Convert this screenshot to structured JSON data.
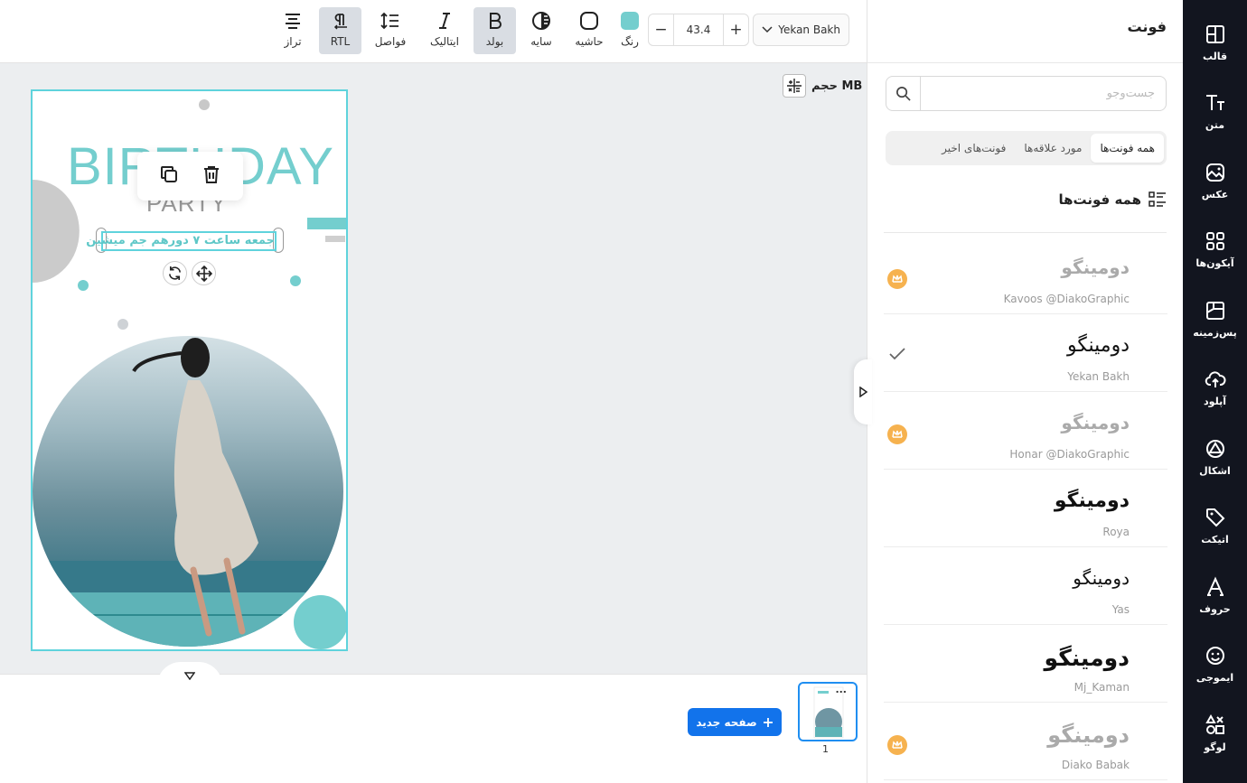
{
  "rail": {
    "items": [
      {
        "label": "قالب",
        "icon": "layout-icon"
      },
      {
        "label": "متن",
        "icon": "text-icon"
      },
      {
        "label": "عکس",
        "icon": "image-icon"
      },
      {
        "label": "آیکون‌ها",
        "icon": "grid-icon"
      },
      {
        "label": "پس‌زمینه",
        "icon": "background-icon"
      },
      {
        "label": "آپلود",
        "icon": "upload-icon"
      },
      {
        "label": "اشکال",
        "icon": "shapes-icon"
      },
      {
        "label": "اتیکت",
        "icon": "tag-icon"
      },
      {
        "label": "حروف",
        "icon": "letters-icon"
      },
      {
        "label": "ایموجی",
        "icon": "emoji-icon"
      },
      {
        "label": "لوگو",
        "icon": "logo-icon"
      }
    ]
  },
  "panel": {
    "title": "فونت",
    "search_placeholder": "جست‌وجو",
    "tabs": [
      "همه فونت‌ها",
      "مورد علاقه‌ها",
      "فونت‌های اخیر"
    ],
    "section_title": "همه فونت‌ها",
    "fonts": [
      {
        "sample": "دومینگو",
        "name": "Kavoos @DiakoGraphic",
        "premium": true,
        "selected": false
      },
      {
        "sample": "دومینگو",
        "name": "Yekan Bakh",
        "premium": false,
        "selected": true
      },
      {
        "sample": "دومینگو",
        "name": "Honar @DiakoGraphic",
        "premium": true,
        "selected": false
      },
      {
        "sample": "دومینگو",
        "name": "Roya",
        "premium": false,
        "selected": false
      },
      {
        "sample": "دومینگو",
        "name": "Yas",
        "premium": false,
        "selected": false
      },
      {
        "sample": "دومینگو",
        "name": "Mj_Kaman",
        "premium": false,
        "selected": false
      },
      {
        "sample": "دومینگو",
        "name": "Diako Babak",
        "premium": true,
        "selected": false
      }
    ]
  },
  "toolbar": {
    "font_family": "Yekan Bakh",
    "font_size": "43.4",
    "color_label": "رنگ",
    "color_value": "#74cece",
    "border_label": "حاشیه",
    "shadow_label": "سایه",
    "bold_label": "بولد",
    "italic_label": "ایتالیک",
    "spacing_label": "فواصل",
    "rtl_label": "RTL",
    "align_label": "تراز"
  },
  "canvas": {
    "size_label": "حجم MB",
    "poster": {
      "title": "BIRTHDAY",
      "subtitle": "PARTY",
      "selected_text": "جمعه ساعت ۷ دورهم جم میشین"
    }
  },
  "pages": {
    "new_page_label": "صفحه جدید",
    "thumb_menu": "...",
    "page_number": "1"
  },
  "colors": {
    "accent": "#74cece",
    "primary_button": "#1273eb",
    "premium_badge": "#f6b24f",
    "rail_bg": "#12151f"
  }
}
